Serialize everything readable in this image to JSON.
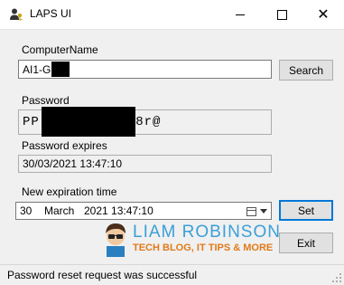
{
  "window": {
    "title": "LAPS UI",
    "icon": "user-key-icon"
  },
  "computer": {
    "label": "ComputerName",
    "value": "AI1-G7",
    "search_label": "Search"
  },
  "password": {
    "label": "Password",
    "value_prefix": "PP(",
    "value_suffix": "8r@"
  },
  "expires": {
    "label": "Password expires",
    "value": "30/03/2021 13:47:10"
  },
  "new_expiration": {
    "label": "New expiration time",
    "day": "30",
    "month": "March",
    "year_time": "2021 13:47:10",
    "set_label": "Set"
  },
  "exit_label": "Exit",
  "watermark": {
    "name": "LIAM ROBINSON",
    "tagline": "TECH BLOG, IT TIPS & MORE"
  },
  "status": {
    "text": "Password reset request was successful"
  },
  "colors": {
    "focus_border": "#0078d7",
    "watermark_blue": "#3aa0d8",
    "watermark_orange": "#e07a1a"
  }
}
